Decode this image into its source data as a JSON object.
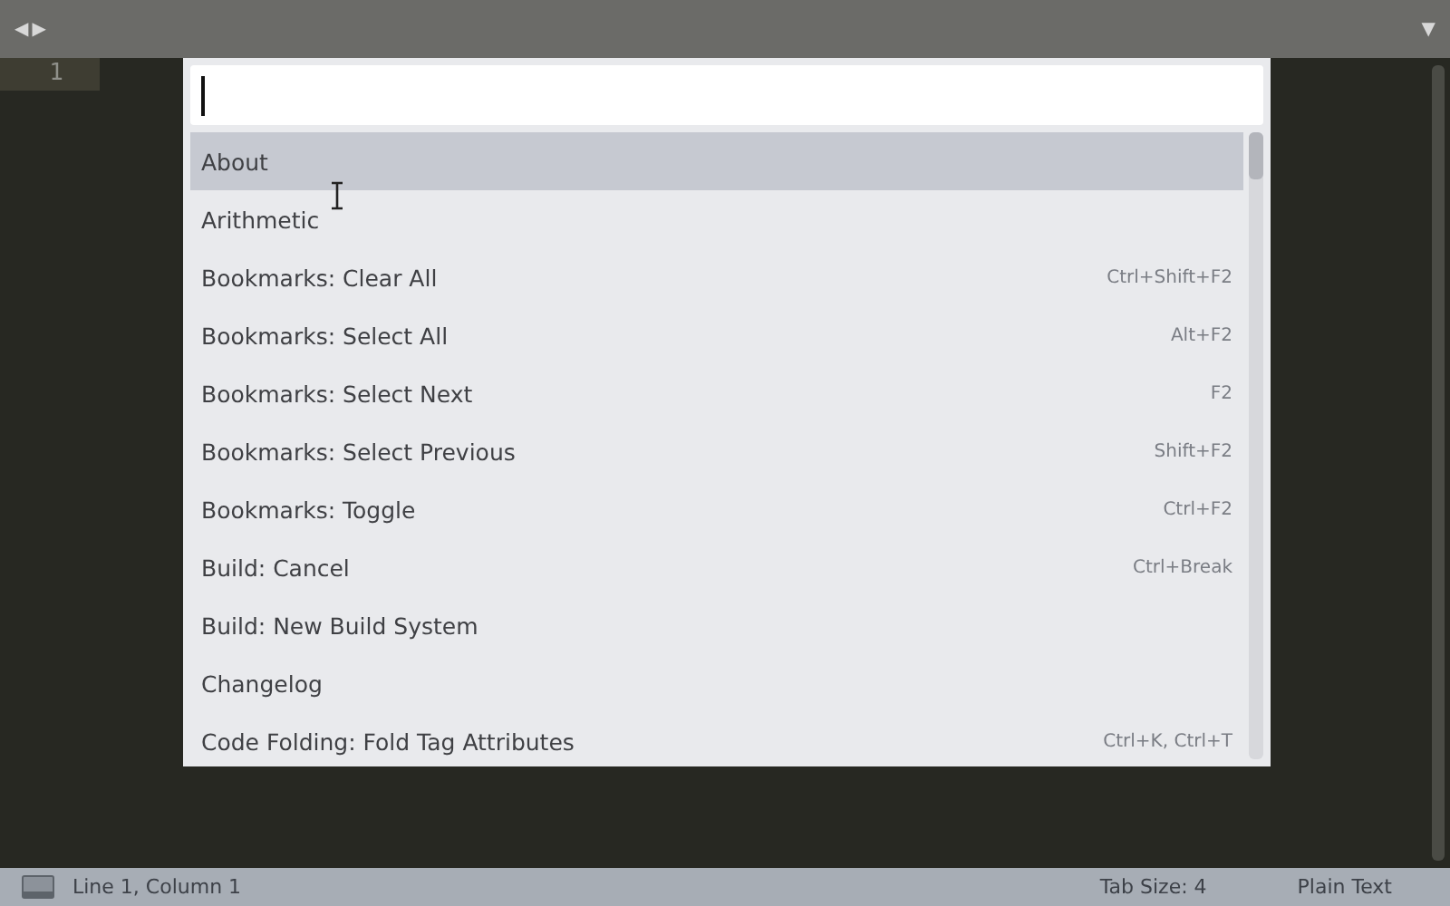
{
  "tab_bar": {
    "nav_left": "◀",
    "nav_right": "▶",
    "menu": "▼"
  },
  "editor": {
    "line_numbers": [
      "1"
    ]
  },
  "command_palette": {
    "items": [
      {
        "label": "About",
        "selected": true
      },
      {
        "label": "Arithmetic",
        "selected": false
      },
      {
        "label": "Bookmarks: Clear All",
        "shortcut": "Ctrl+Shift+F2",
        "selected": false
      },
      {
        "label": "Bookmarks: Select All",
        "shortcut": "Alt+F2",
        "selected": false
      },
      {
        "label": "Bookmarks: Select Next",
        "shortcut": "F2",
        "selected": false
      },
      {
        "label": "Bookmarks: Select Previous",
        "shortcut": "Shift+F2",
        "selected": false
      },
      {
        "label": "Bookmarks: Toggle",
        "shortcut": "Ctrl+F2",
        "selected": false
      },
      {
        "label": "Build: Cancel",
        "shortcut": "Ctrl+Break",
        "selected": false
      },
      {
        "label": "Build: New Build System",
        "selected": false
      },
      {
        "label": "Changelog",
        "selected": false
      },
      {
        "label": "Code Folding: Fold Tag Attributes",
        "shortcut": "Ctrl+K, Ctrl+T",
        "selected": false
      }
    ]
  },
  "status_bar": {
    "position": "Line 1, Column 1",
    "tab_size": "Tab Size: 4",
    "syntax": "Plain Text"
  }
}
